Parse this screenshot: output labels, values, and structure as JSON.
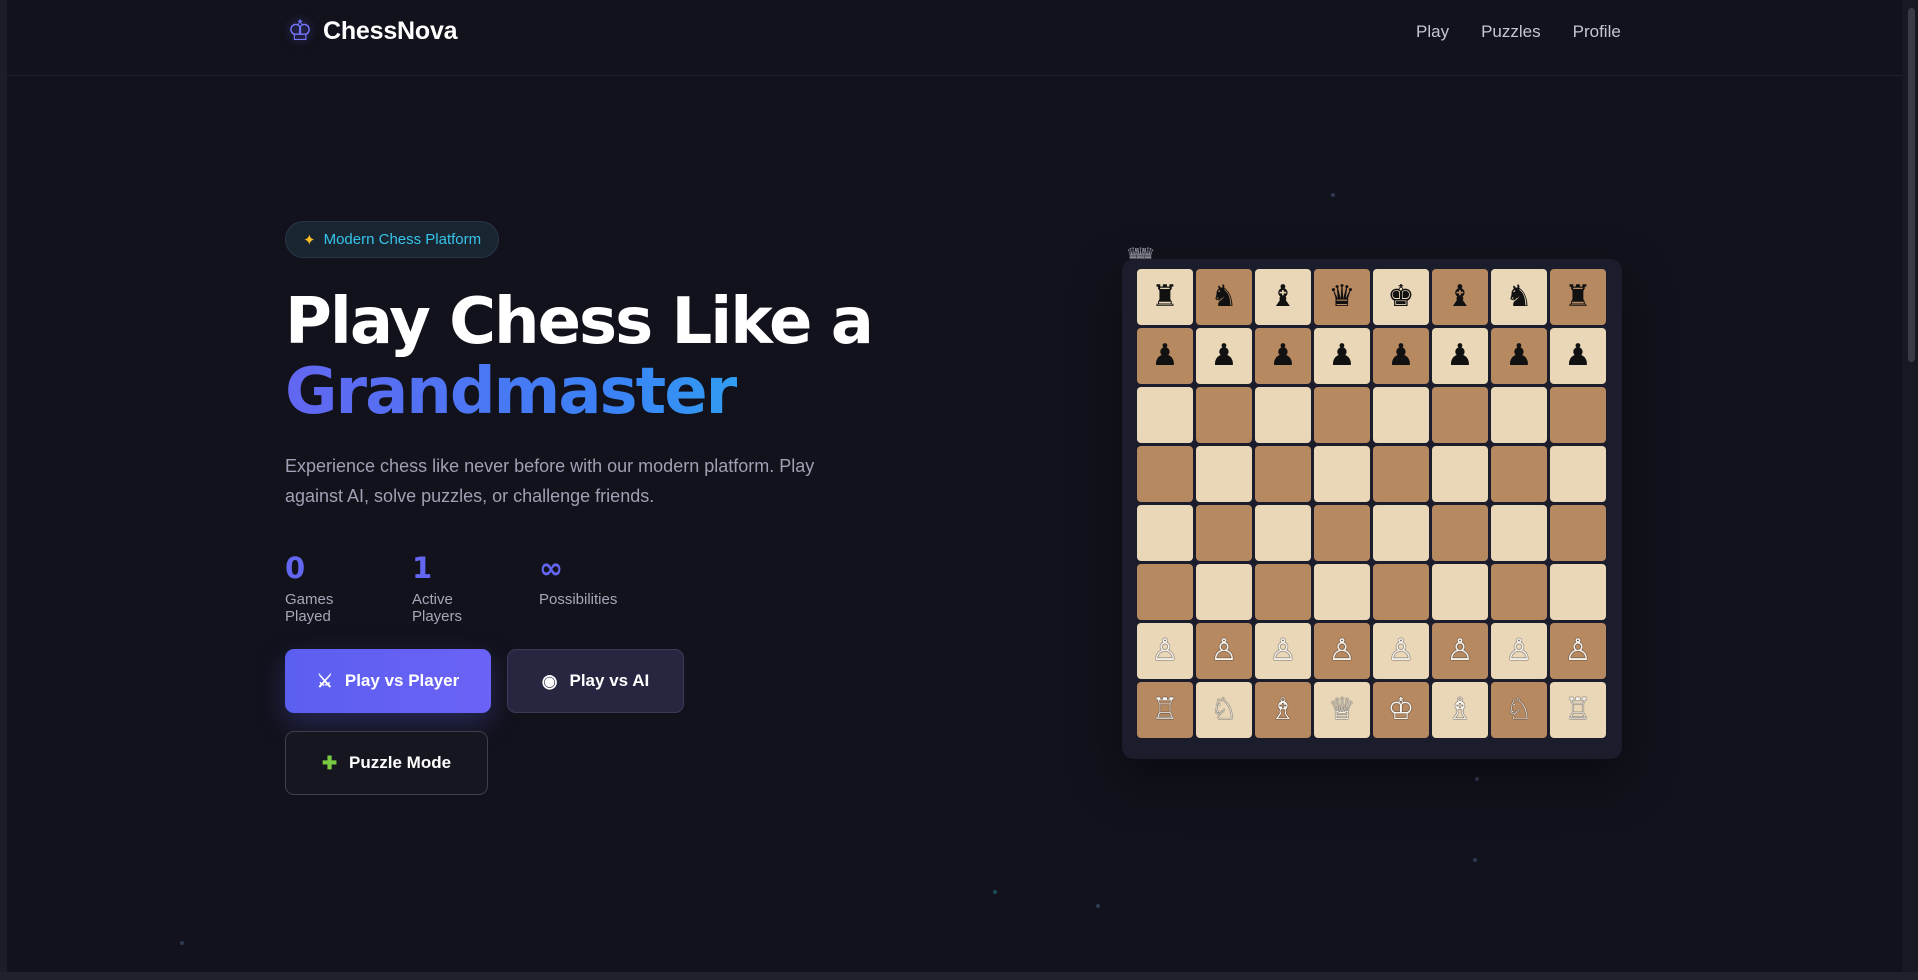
{
  "app": {
    "brand_name": "ChessNova",
    "brand_icon": "crown-icon"
  },
  "nav": {
    "items": [
      "Play",
      "Puzzles",
      "Profile"
    ]
  },
  "hero": {
    "badge_icon": "sparkle-icon",
    "badge_text": "Modern Chess Platform",
    "title_line_1": "Play Chess Like a",
    "title_line_2": "Grandmaster",
    "subtitle": "Experience chess like never before with our modern platform. Play against AI, solve puzzles, or challenge friends."
  },
  "stats": [
    {
      "value": "0",
      "label": "Games Played"
    },
    {
      "value": "1",
      "label": "Active Players"
    },
    {
      "value": "∞",
      "label": "Possibilities"
    }
  ],
  "buttons": {
    "play_vs_player": "Play vs Player",
    "play_vs_ai": "Play vs AI",
    "puzzle_mode": "Puzzle Mode",
    "play_vs_player_icon": "crossed-swords-icon",
    "play_vs_ai_icon": "robot-icon",
    "puzzle_mode_icon": "puzzle-piece-icon"
  },
  "board": {
    "rows": [
      [
        "♜",
        "♞",
        "♝",
        "♛",
        "♚",
        "♝",
        "♞",
        "♜"
      ],
      [
        "♟",
        "♟",
        "♟",
        "♟",
        "♟",
        "♟",
        "♟",
        "♟"
      ],
      [
        "",
        "",
        "",
        "",
        "",
        "",
        "",
        ""
      ],
      [
        "",
        "",
        "",
        "",
        "",
        "",
        "",
        ""
      ],
      [
        "",
        "",
        "",
        "",
        "",
        "",
        "",
        ""
      ],
      [
        "",
        "",
        "",
        "",
        "",
        "",
        "",
        ""
      ],
      [
        "♙",
        "♙",
        "♙",
        "♙",
        "♙",
        "♙",
        "♙",
        "♙"
      ],
      [
        "♖",
        "♘",
        "♗",
        "♕",
        "♔",
        "♗",
        "♘",
        "♖"
      ]
    ]
  },
  "colors": {
    "background": "#11121b",
    "accent": "#6366f1",
    "cyan": "#22c7eb",
    "light_square": "#e9d7b8",
    "dark_square": "#b78961"
  }
}
